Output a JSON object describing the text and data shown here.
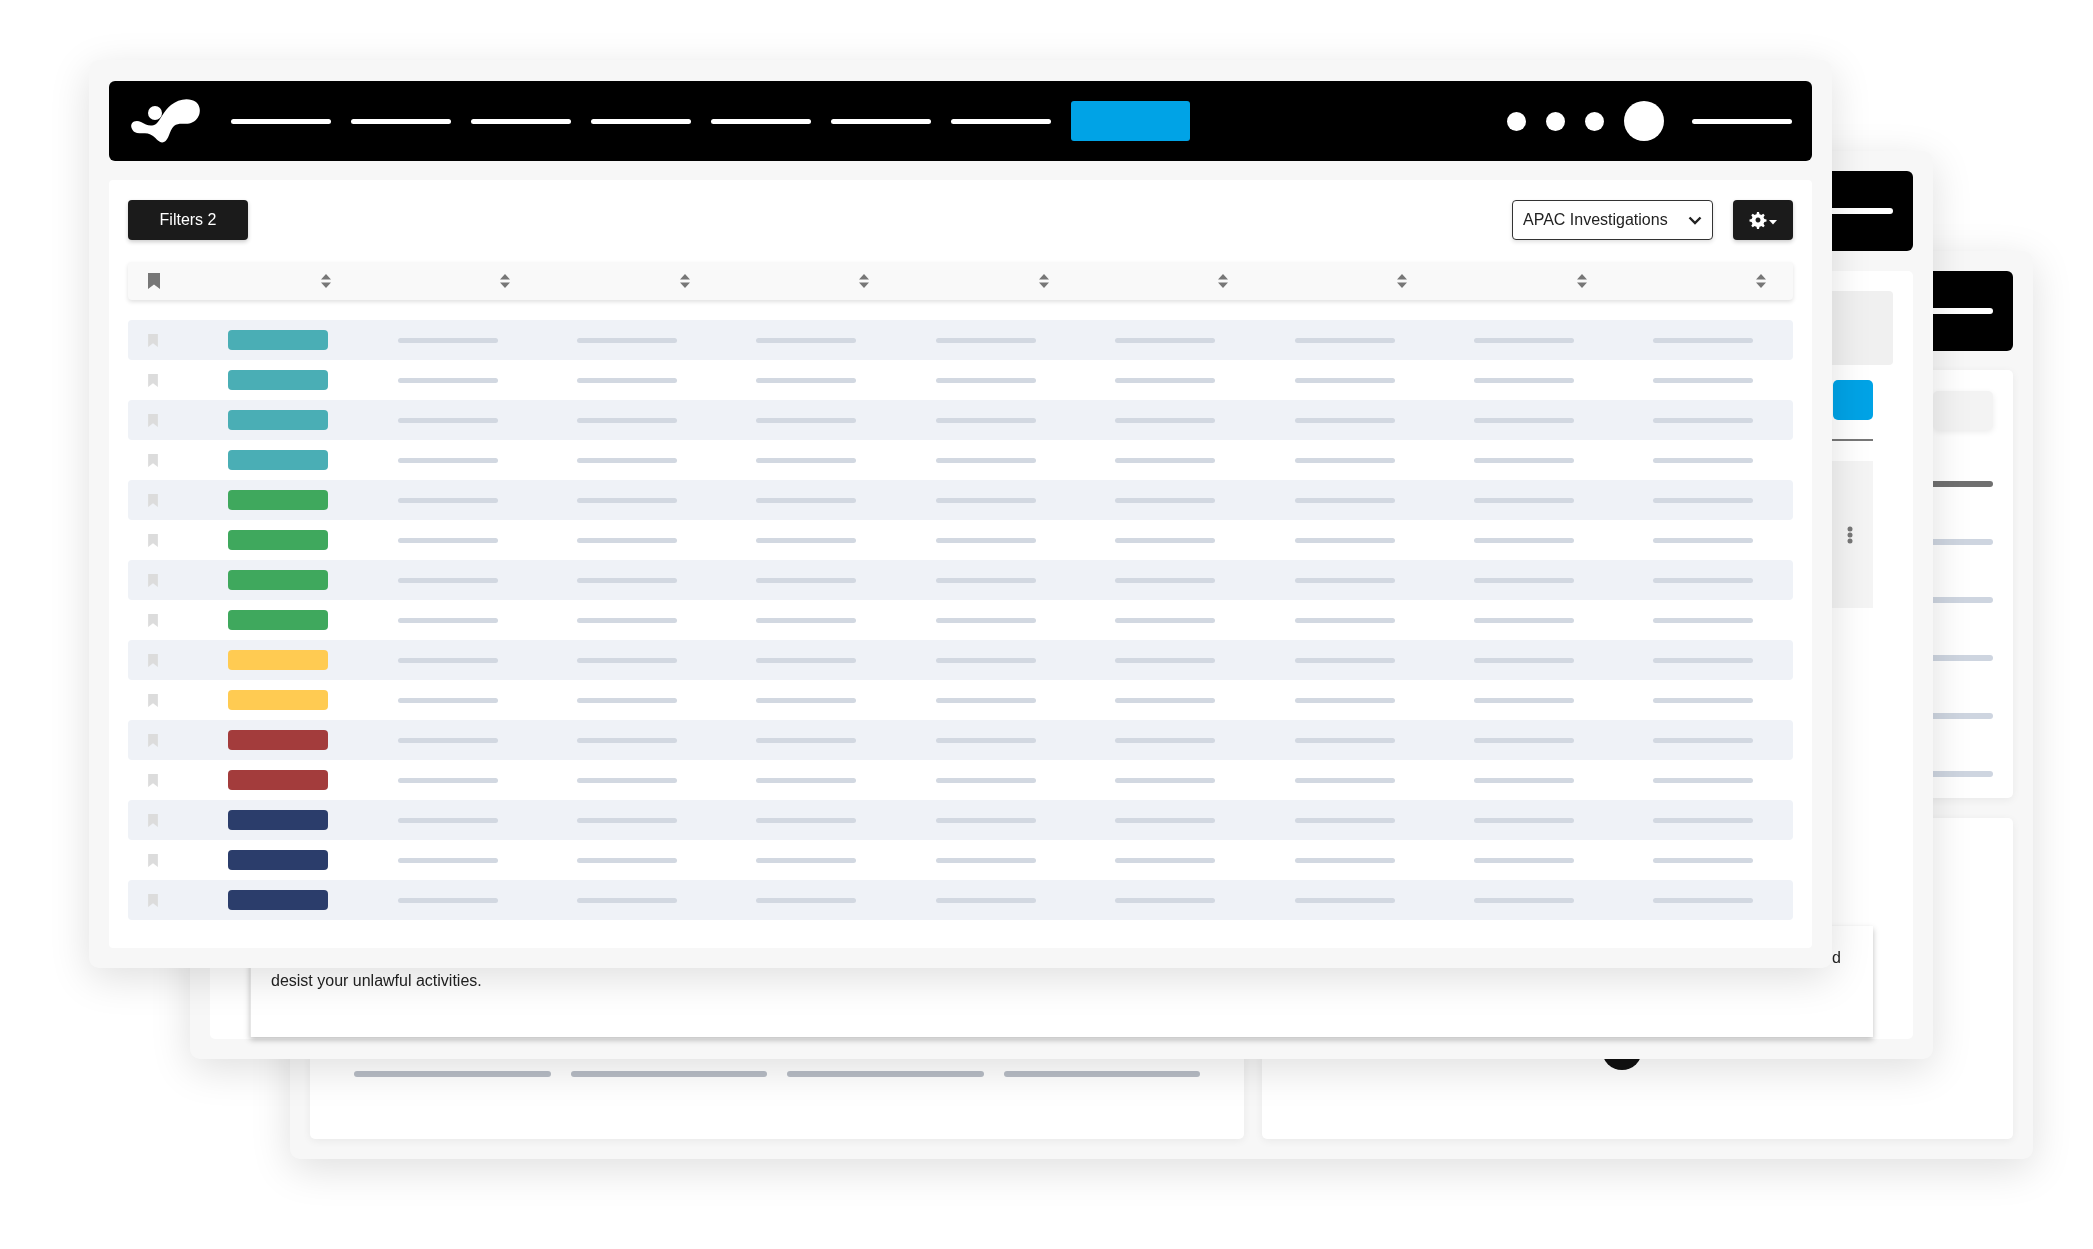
{
  "front_window": {
    "toolbar": {
      "filters_button": {
        "label": "Filters 2"
      },
      "view_select": {
        "value": "APAC Investigations"
      }
    },
    "table": {
      "rows": [
        {
          "color": "#4aaeb5"
        },
        {
          "color": "#4aaeb5"
        },
        {
          "color": "#4aaeb5"
        },
        {
          "color": "#4aaeb5"
        },
        {
          "color": "#3fa85d"
        },
        {
          "color": "#3fa85d"
        },
        {
          "color": "#3fa85d"
        },
        {
          "color": "#3fa85d"
        },
        {
          "color": "#ffcb52"
        },
        {
          "color": "#ffcb52"
        },
        {
          "color": "#a33c3c"
        },
        {
          "color": "#a33c3c"
        },
        {
          "color": "#2b3d6b"
        },
        {
          "color": "#2b3d6b"
        },
        {
          "color": "#2b3d6b"
        }
      ]
    }
  },
  "middle_window": {
    "letter": {
      "line_end": "d",
      "last_line": "desist your unlawful activities."
    }
  }
}
